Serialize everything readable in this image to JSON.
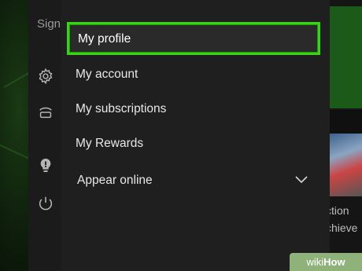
{
  "sidebar": {
    "sign_label": "Sign",
    "icons": [
      "gear-icon",
      "controller-icon",
      "lightbulb-icon",
      "power-icon"
    ]
  },
  "menu": {
    "items": [
      {
        "label": "My profile",
        "selected": true
      },
      {
        "label": "My account"
      },
      {
        "label": "My subscriptions"
      },
      {
        "label": "My Rewards"
      },
      {
        "label": "Appear online",
        "has_dropdown": true
      }
    ],
    "highlight_color": "#3bd316"
  },
  "background": {
    "text_1": "ction",
    "text_2": "chieve"
  },
  "watermark": {
    "prefix": "wiki",
    "suffix": "How"
  }
}
